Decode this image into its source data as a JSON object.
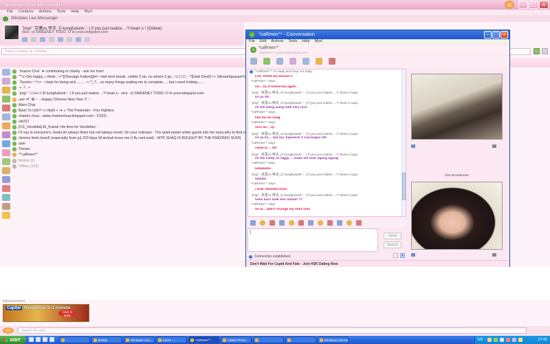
{
  "main_window": {
    "title": "Windows Live Messenger",
    "menu": [
      "File",
      "Contacts",
      "Actions",
      "Tools",
      "Help",
      "Mys!"
    ],
    "header": "Windows Live Messenger",
    "profile": {
      "display_name": "\"jmg² ' 京薔vs.帝夫_D kungfudunk♡  { if you just realize ...*I heart u ¹  (Online)",
      "status_line": "sick. :x[      SWEENEY TODD :D        le-yooo.blogspot.com"
    },
    "search_placeholder": "Find a contact or number..."
  },
  "contacts": [
    {
      "text": "`Imacre Crisi¨ ➤ contributing to charity - ask me how!",
      "state": "online"
    },
    {
      "text": "\"^'x'<3m happy...i think...'+°'[[Teenage Failure]]Hi~~mid term break...nothin 2 do..no where 2 go...'<□□□□ - '*[Dark Devil]'<'+ Sãnaeh∆payam’h¨¨°• ∆ακααι∆αιω∆ ;;",
      "state": "online"
    },
    {
      "text": "`Tseshu~~*<> - i hate for being sick ........ :<  ?_?... so many things waiting me to complete......but i need holiday.......",
      "state": "online"
    },
    {
      "text": "·•· ? .·•·",
      "state": "online"
    },
    {
      "text": "`jmg²   ' □□vs.□□D kungfudunk♡  { if you just realize ...*I heart u - sick. :x[   SWEENEY TODD :D        le-yooo.blogspot.com",
      "state": "online"
    },
    {
      "text": "¡ver·•i!¨ ✿ ~ ...Happy Chinese New Year !!! ~",
      "state": "away"
    },
    {
      "text": "Alien Chat",
      "state": "online"
    },
    {
      "text": "Back To Life!!!  <» Mylh « ➜ ♫ The Pretender - Foo Fighters",
      "state": "online"
    },
    {
      "text": "charles chua - www.charleschua.blogspot.com - COOL",
      "state": "online"
    },
    {
      "text": "ckt317",
      "state": "online"
    },
    {
      "text": "[CS_Vendetta]  El_Kamal <its time for Vendetta> -",
      "state": "online"
    },
    {
      "text": "I'd say in everyone's Jester,im always there but not always loved. On your suitcase - The quiet power writer gazes into her eyes,why to find confusion in herself",
      "state": "online"
    },
    {
      "text": "Jeremy feels loved! (especially from ju) 223 days till amirah loves me (I fly cant wait) - WTF SHAQ IS BOUGHT BY THE PHEONIX! SUNS",
      "state": "online"
    },
    {
      "text": "sam",
      "state": "online"
    },
    {
      "text": "Theam",
      "state": "online"
    },
    {
      "text": "*°caRmen°*",
      "state": "away"
    },
    {
      "text": "Mobile (0)",
      "state": "offline"
    },
    {
      "text": "Offline (123)",
      "state": "offline"
    }
  ],
  "ad": {
    "label": "Advertisement",
    "brand": "Capital",
    "text": "Response in 1 minute",
    "cta": "Click to apply"
  },
  "bottom_search_placeholder": "Search the web...",
  "conversation": {
    "title": "*caRmen°* - Conversation",
    "menu": [
      "File",
      "Edit",
      "Actions",
      "Tools",
      "Help",
      "Mys!"
    ],
    "to_name": "*caRmen°*",
    "to_psm": "*caRmen°* <carmen@hotmail.com>",
    "away_notice": "\"*caRmen°*\" is Away and may not reply.",
    "messages": [
      {
        "type": "msg",
        "who": "them",
        "text": "LOL YEAH we should !!"
      },
      {
        "type": "said",
        "text": "*caRmen°* says"
      },
      {
        "type": "msg",
        "who": "them",
        "text": "lol... try it tomorrow again"
      },
      {
        "type": "said",
        "text": "\"jmg²                   ' 京薔vs.帝夫_D kungfudunk♡  { if you just realize ...*I heart u says"
      },
      {
        "type": "msg",
        "who": "me",
        "text": "lol ya XD"
      },
      {
        "type": "said",
        "text": "\"jmg²                   ' 京薔vs.帝夫_D kungfudunk♡  { if you just realize ...*I heart u says"
      },
      {
        "type": "msg",
        "who": "me",
        "text": "eh the wang wang milk very nice"
      },
      {
        "type": "said",
        "text": "*caRmen°* says"
      },
      {
        "type": "msg",
        "who": "them",
        "text": "like bai ku sang"
      },
      {
        "type": "said",
        "text": "*caRmen°* says"
      },
      {
        "type": "msg",
        "who": "them",
        "text": "nice ler... xp"
      },
      {
        "type": "said",
        "text": "\"jmg²                   ' 京薔vs.帝夫_D kungfudunk♡  { if you just realize ...*I heart u says"
      },
      {
        "type": "msg",
        "who": "me",
        "text": "lol ya ka ... but my Japanese 1 sua-bagus XD"
      },
      {
        "type": "said",
        "text": "*caRmen°* says"
      },
      {
        "type": "msg",
        "who": "them",
        "text": "same la ... XD"
      },
      {
        "type": "said",
        "text": "\"jmg²                   ' 京薔vs.帝夫_D kungfudunk♡  { if you just realize ...*I heart u says"
      },
      {
        "type": "msg",
        "who": "me",
        "text": "eh the camp so laggy ... make me look ngang ngang"
      },
      {
        "type": "said",
        "text": "*caRmen°* says"
      },
      {
        "type": "msg",
        "who": "them",
        "text": "bababaha"
      },
      {
        "type": "said",
        "text": "\"jmg²                   ' 京薔vs.帝夫_D kungfudunk♡  { if you just realize ...*I heart u says"
      },
      {
        "type": "msg",
        "who": "me",
        "text": "lalalala"
      },
      {
        "type": "said",
        "text": "*caRmen°* says"
      },
      {
        "type": "msg",
        "who": "them",
        "text": "i look retarded man!"
      },
      {
        "type": "said",
        "text": "\"jmg²                   ' 京薔vs.帝夫_D kungfudunk♡  { if you just realize ...*I heart u says"
      },
      {
        "type": "msg",
        "who": "me",
        "text": "haha baru baik dari shatah ??"
      },
      {
        "type": "said",
        "text": "*caRmen°* says"
      },
      {
        "type": "msg",
        "who": "them",
        "text": "ne la... didn't change my shirt only"
      }
    ],
    "input_value": "|",
    "send_label": "Send",
    "search_label": "Search",
    "connection_status": "Connection established.",
    "ad_text": "Don't Wait For Cupid And Fate - Join HSK Dating Now",
    "cam_label": "Get accessories"
  },
  "taskbar": {
    "start_label": "start",
    "tasks": [
      "",
      "[MSN]",
      "Windows Live...",
      "ЬΟοΥ - ...",
      "*caRmen°*...",
      "Adobe Photo...",
      "",
      "",
      "Windows Live Me..."
    ],
    "lang": "EN",
    "clock": "17:42"
  },
  "colors": {
    "main_theme": "#f8d6e7",
    "conv_titlebar": "#1f56c9",
    "msg_them": "#e0144a",
    "msg_me": "#9a2fa0",
    "taskbar": "#2256d0"
  }
}
